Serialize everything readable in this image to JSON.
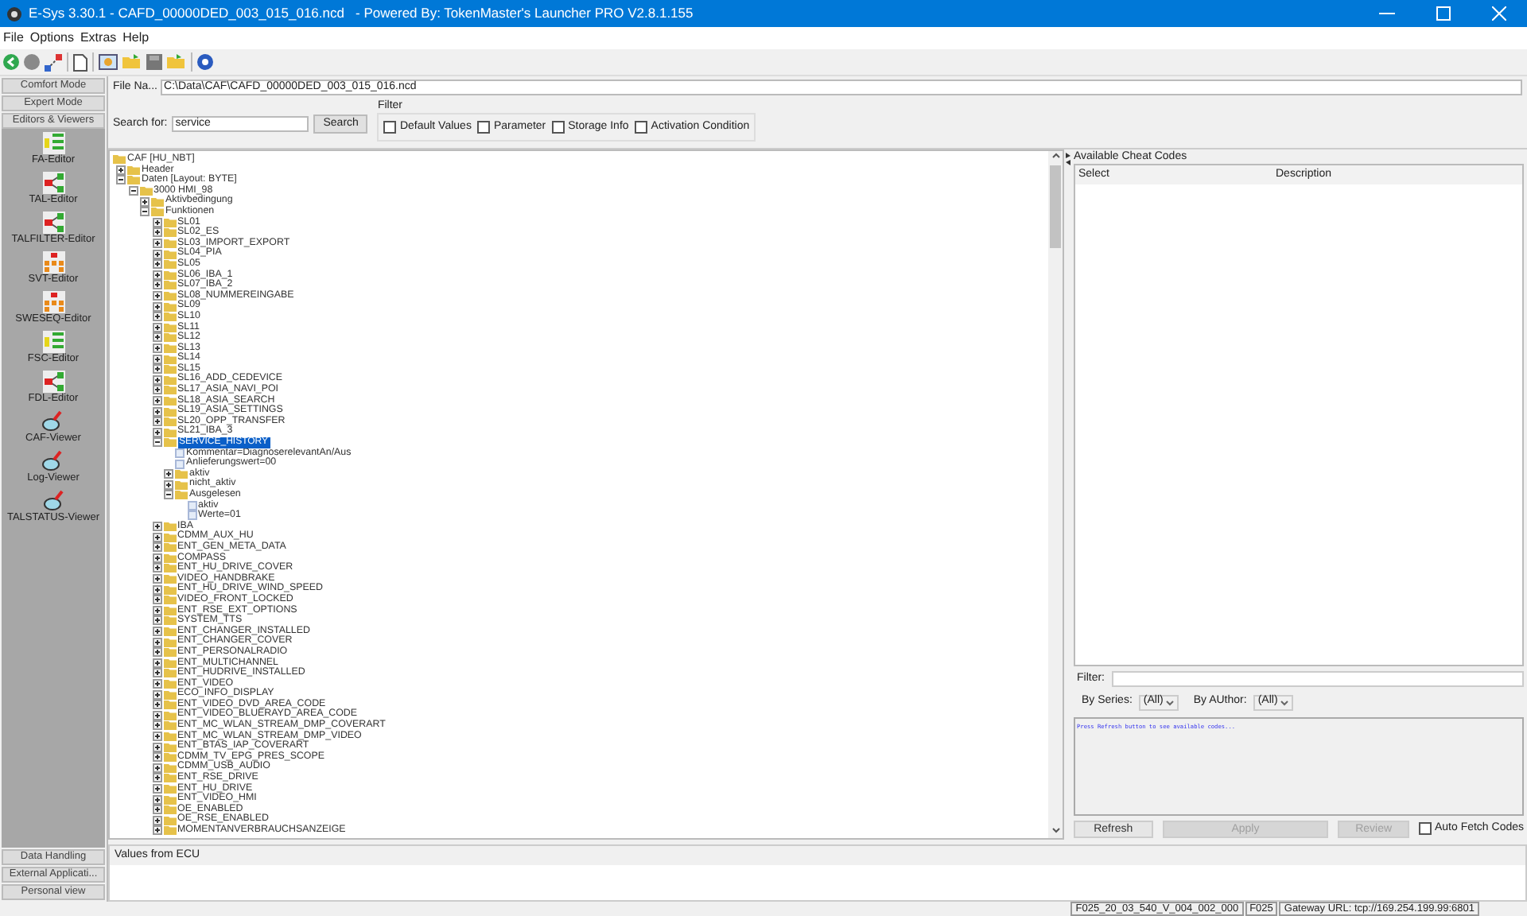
{
  "window": {
    "title": "E-Sys 3.30.1 - CAFD_00000DED_003_015_016.ncd   - Powered By: TokenMaster's Launcher PRO V2.8.1.155"
  },
  "menu": [
    "File",
    "Options",
    "Extras",
    "Help"
  ],
  "sidebar": {
    "top_buttons": [
      "Comfort Mode",
      "Expert Mode",
      "Editors & Viewers"
    ],
    "tools": [
      {
        "label": "FA-Editor",
        "kind": "list"
      },
      {
        "label": "TAL-Editor",
        "kind": "graph"
      },
      {
        "label": "TALFILTER-Editor",
        "kind": "graph"
      },
      {
        "label": "SVT-Editor",
        "kind": "tree"
      },
      {
        "label": "SWESEQ-Editor",
        "kind": "tree"
      },
      {
        "label": "FSC-Editor",
        "kind": "list"
      },
      {
        "label": "FDL-Editor",
        "kind": "graph"
      },
      {
        "label": "CAF-Viewer",
        "kind": "viewer"
      },
      {
        "label": "Log-Viewer",
        "kind": "viewer"
      },
      {
        "label": "TALSTATUS-Viewer",
        "kind": "viewer"
      }
    ],
    "bottom_buttons": [
      "Data Handling",
      "External Applicati...",
      "Personal view"
    ]
  },
  "file": {
    "label": "File Na...",
    "value": "C:\\Data\\CAF\\CAFD_00000DED_003_015_016.ncd"
  },
  "search": {
    "label": "Search for:",
    "value": "service",
    "button": "Search"
  },
  "filter": {
    "title": "Filter",
    "options": [
      {
        "label": "Default Values",
        "checked": false
      },
      {
        "label": "Parameter",
        "checked": false
      },
      {
        "label": "Storage Info",
        "checked": false
      },
      {
        "label": "Activation Condition",
        "checked": false
      }
    ]
  },
  "tree": [
    {
      "label": "CAF [HU_NBT]",
      "kind": "folder",
      "selected": false,
      "children": [
        {
          "label": "Header",
          "kind": "folder",
          "expanded": false,
          "selected": false
        },
        {
          "label": "Daten [Layout: BYTE]",
          "kind": "folder",
          "expanded": true,
          "selected": false,
          "children": [
            {
              "label": "3000 HMI_98",
              "kind": "folder",
              "expanded": true,
              "selected": false,
              "children": [
                {
                  "label": "Aktivbedingung",
                  "kind": "folder",
                  "expanded": false,
                  "selected": false
                },
                {
                  "label": "Funktionen",
                  "kind": "folder",
                  "expanded": true,
                  "selected": false,
                  "children": [
                    {
                      "label": "SL01",
                      "kind": "folder",
                      "expanded": false,
                      "selected": false
                    },
                    {
                      "label": "SL02_ES",
                      "kind": "folder",
                      "expanded": false,
                      "selected": false
                    },
                    {
                      "label": "SL03_IMPORT_EXPORT",
                      "kind": "folder",
                      "expanded": false,
                      "selected": false
                    },
                    {
                      "label": "SL04_PIA",
                      "kind": "folder",
                      "expanded": false,
                      "selected": false
                    },
                    {
                      "label": "SL05",
                      "kind": "folder",
                      "expanded": false,
                      "selected": false
                    },
                    {
                      "label": "SL06_IBA_1",
                      "kind": "folder",
                      "expanded": false,
                      "selected": false
                    },
                    {
                      "label": "SL07_IBA_2",
                      "kind": "folder",
                      "expanded": false,
                      "selected": false
                    },
                    {
                      "label": "SL08_NUMMEREINGABE",
                      "kind": "folder",
                      "expanded": false,
                      "selected": false
                    },
                    {
                      "label": "SL09",
                      "kind": "folder",
                      "expanded": false,
                      "selected": false
                    },
                    {
                      "label": "SL10",
                      "kind": "folder",
                      "expanded": false,
                      "selected": false
                    },
                    {
                      "label": "SL11",
                      "kind": "folder",
                      "expanded": false,
                      "selected": false
                    },
                    {
                      "label": "SL12",
                      "kind": "folder",
                      "expanded": false,
                      "selected": false
                    },
                    {
                      "label": "SL13",
                      "kind": "folder",
                      "expanded": false,
                      "selected": false
                    },
                    {
                      "label": "SL14",
                      "kind": "folder",
                      "expanded": false,
                      "selected": false
                    },
                    {
                      "label": "SL15",
                      "kind": "folder",
                      "expanded": false,
                      "selected": false
                    },
                    {
                      "label": "SL16_ADD_CEDEVICE",
                      "kind": "folder",
                      "expanded": false,
                      "selected": false
                    },
                    {
                      "label": "SL17_ASIA_NAVI_POI",
                      "kind": "folder",
                      "expanded": false,
                      "selected": false
                    },
                    {
                      "label": "SL18_ASIA_SEARCH",
                      "kind": "folder",
                      "expanded": false,
                      "selected": false
                    },
                    {
                      "label": "SL19_ASIA_SETTINGS",
                      "kind": "folder",
                      "expanded": false,
                      "selected": false
                    },
                    {
                      "label": "SL20_OPP_TRANSFER",
                      "kind": "folder",
                      "expanded": false,
                      "selected": false
                    },
                    {
                      "label": "SL21_IBA_3",
                      "kind": "folder",
                      "expanded": false,
                      "selected": false
                    },
                    {
                      "label": "SERVICE_HISTORY",
                      "kind": "folder",
                      "expanded": true,
                      "selected": true,
                      "children": [
                        {
                          "label": "Kommentar=DiagnoserelevantAn/Aus",
                          "kind": "item",
                          "selected": false
                        },
                        {
                          "label": "Anlieferungswert=00",
                          "kind": "item",
                          "selected": false
                        },
                        {
                          "label": "aktiv",
                          "kind": "folder",
                          "expanded": false,
                          "selected": false
                        },
                        {
                          "label": "nicht_aktiv",
                          "kind": "folder",
                          "expanded": false,
                          "selected": false
                        },
                        {
                          "label": "Ausgelesen",
                          "kind": "folder",
                          "expanded": true,
                          "selected": false,
                          "children": [
                            {
                              "label": "aktiv",
                              "kind": "item",
                              "selected": false
                            },
                            {
                              "label": "Werte=01",
                              "kind": "item",
                              "selected": false
                            }
                          ]
                        }
                      ]
                    },
                    {
                      "label": "IBA",
                      "kind": "folder",
                      "expanded": false,
                      "selected": false
                    },
                    {
                      "label": "CDMM_AUX_HU",
                      "kind": "folder",
                      "expanded": false,
                      "selected": false
                    },
                    {
                      "label": "ENT_GEN_META_DATA",
                      "kind": "folder",
                      "expanded": false,
                      "selected": false
                    },
                    {
                      "label": "COMPASS",
                      "kind": "folder",
                      "expanded": false,
                      "selected": false
                    },
                    {
                      "label": "ENT_HU_DRIVE_COVER",
                      "kind": "folder",
                      "expanded": false,
                      "selected": false
                    },
                    {
                      "label": "VIDEO_HANDBRAKE",
                      "kind": "folder",
                      "expanded": false,
                      "selected": false
                    },
                    {
                      "label": "ENT_HU_DRIVE_WIND_SPEED",
                      "kind": "folder",
                      "expanded": false,
                      "selected": false
                    },
                    {
                      "label": "VIDEO_FRONT_LOCKED",
                      "kind": "folder",
                      "expanded": false,
                      "selected": false
                    },
                    {
                      "label": "ENT_RSE_EXT_OPTIONS",
                      "kind": "folder",
                      "expanded": false,
                      "selected": false
                    },
                    {
                      "label": "SYSTEM_TTS",
                      "kind": "folder",
                      "expanded": false,
                      "selected": false
                    },
                    {
                      "label": "ENT_CHANGER_INSTALLED",
                      "kind": "folder",
                      "expanded": false,
                      "selected": false
                    },
                    {
                      "label": "ENT_CHANGER_COVER",
                      "kind": "folder",
                      "expanded": false,
                      "selected": false
                    },
                    {
                      "label": "ENT_PERSONALRADIO",
                      "kind": "folder",
                      "expanded": false,
                      "selected": false
                    },
                    {
                      "label": "ENT_MULTICHANNEL",
                      "kind": "folder",
                      "expanded": false,
                      "selected": false
                    },
                    {
                      "label": "ENT_HUDRIVE_INSTALLED",
                      "kind": "folder",
                      "expanded": false,
                      "selected": false
                    },
                    {
                      "label": "ENT_VIDEO",
                      "kind": "folder",
                      "expanded": false,
                      "selected": false
                    },
                    {
                      "label": "ECO_INFO_DISPLAY",
                      "kind": "folder",
                      "expanded": false,
                      "selected": false
                    },
                    {
                      "label": "ENT_VIDEO_DVD_AREA_CODE",
                      "kind": "folder",
                      "expanded": false,
                      "selected": false
                    },
                    {
                      "label": "ENT_VIDEO_BLUERAYD_AREA_CODE",
                      "kind": "folder",
                      "expanded": false,
                      "selected": false
                    },
                    {
                      "label": "ENT_MC_WLAN_STREAM_DMP_COVERART",
                      "kind": "folder",
                      "expanded": false,
                      "selected": false
                    },
                    {
                      "label": "ENT_MC_WLAN_STREAM_DMP_VIDEO",
                      "kind": "folder",
                      "expanded": false,
                      "selected": false
                    },
                    {
                      "label": "ENT_BTAS_IAP_COVERART",
                      "kind": "folder",
                      "expanded": false,
                      "selected": false
                    },
                    {
                      "label": "CDMM_TV_EPG_PRES_SCOPE",
                      "kind": "folder",
                      "expanded": false,
                      "selected": false
                    },
                    {
                      "label": "CDMM_USB_AUDIO",
                      "kind": "folder",
                      "expanded": false,
                      "selected": false
                    },
                    {
                      "label": "ENT_RSE_DRIVE",
                      "kind": "folder",
                      "expanded": false,
                      "selected": false
                    },
                    {
                      "label": "ENT_HU_DRIVE",
                      "kind": "folder",
                      "expanded": false,
                      "selected": false
                    },
                    {
                      "label": "ENT_VIDEO_HMI",
                      "kind": "folder",
                      "expanded": false,
                      "selected": false
                    },
                    {
                      "label": "OE_ENABLED",
                      "kind": "folder",
                      "expanded": false,
                      "selected": false
                    },
                    {
                      "label": "OE_RSE_ENABLED",
                      "kind": "folder",
                      "expanded": false,
                      "selected": false
                    },
                    {
                      "label": "MOMENTANVERBRAUCHSANZEIGE",
                      "kind": "folder",
                      "expanded": false,
                      "selected": false
                    }
                  ]
                }
              ]
            }
          ]
        }
      ]
    }
  ],
  "cheat_codes": {
    "title": "Available Cheat Codes",
    "columns": [
      "Select",
      "Description"
    ],
    "filter_label": "Filter:",
    "series_label": "By Series:",
    "series_value": "(All)",
    "author_label": "By AUthor:",
    "author_value": "(All)",
    "message": "Press Refresh button to see available codes...",
    "buttons": [
      {
        "label": "Refresh",
        "disabled": false
      },
      {
        "label": "Apply",
        "disabled": true
      },
      {
        "label": "Review",
        "disabled": true
      }
    ],
    "auto_fetch": {
      "label": "Auto Fetch Codes",
      "checked": false
    }
  },
  "ecu_panel": {
    "title": "Values from ECU"
  },
  "status_bar": [
    "F025_20_03_540_V_004_002_000",
    "F025",
    "Gateway URL: tcp://169.254.199.99:6801"
  ]
}
